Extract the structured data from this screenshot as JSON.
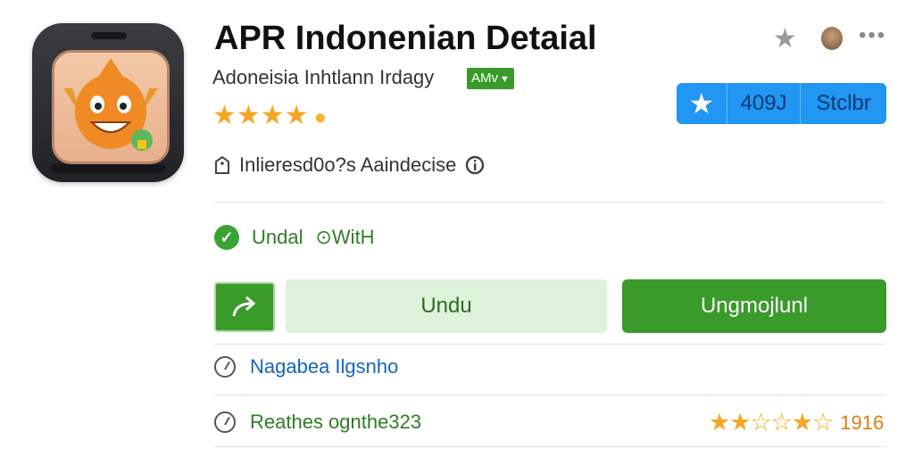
{
  "header": {
    "title": "APR Indonenian Detaial",
    "subtitle": "Adoneisia Inhtlann Irdagy",
    "badge_label": "AMv",
    "star_icon": "star-icon",
    "more_icon": "more-icon"
  },
  "rating_top": {
    "stars": "★★★★",
    "extra": "●"
  },
  "rate_button": {
    "star_glyph": "★",
    "value": "409J",
    "label": "Stclbr"
  },
  "info": {
    "text": "Inlieresd0o?s Aaindecise"
  },
  "status": {
    "check": "✓",
    "text": "Undal",
    "clock_text": "⊙WitH"
  },
  "actions": {
    "share_glyph": "↪",
    "undu_label": "Undu",
    "install_label": "Ungmojlunl"
  },
  "rows": [
    {
      "text": "Nagabea Ilgsnho"
    },
    {
      "text": "Reathes ognthe323"
    }
  ],
  "rating_bottom": {
    "stars": "★★☆☆★☆",
    "value": "1916"
  },
  "colors": {
    "accent_green": "#3a9a2a",
    "light_green": "#dff2db",
    "blue": "#2196f3",
    "star": "#f5a623"
  }
}
